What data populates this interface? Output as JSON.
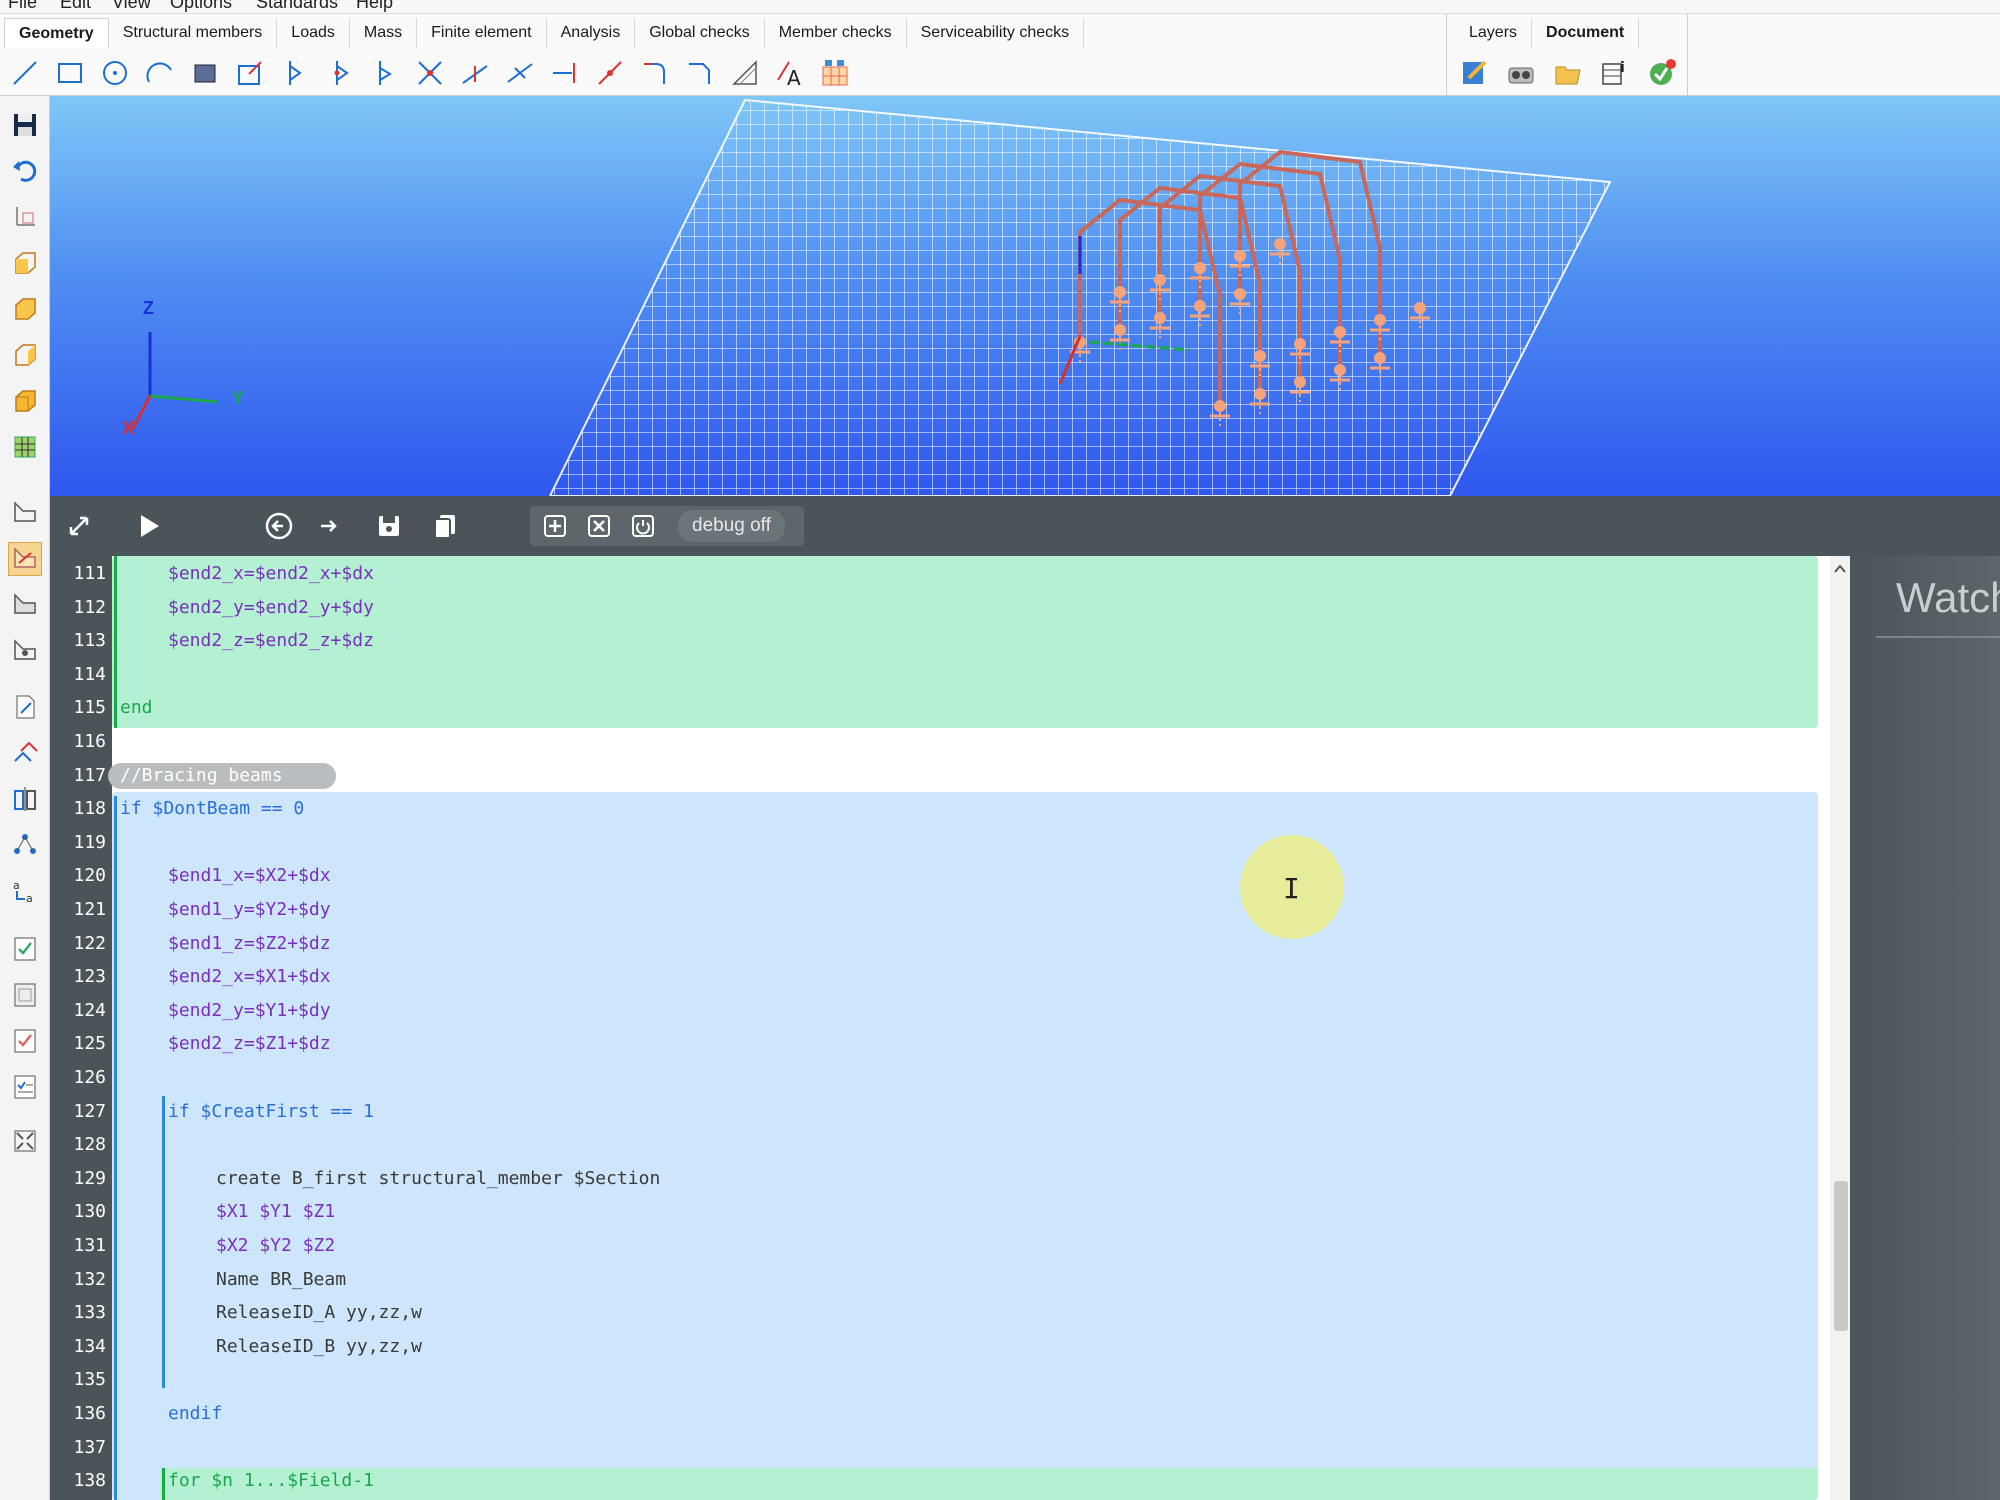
{
  "menu": [
    "File",
    "Edit",
    "View",
    "Options",
    "Standards",
    "Help"
  ],
  "ribbon": {
    "tabs": [
      "Geometry",
      "Structural members",
      "Loads",
      "Mass",
      "Finite element",
      "Analysis",
      "Global checks",
      "Member checks",
      "Serviceability checks"
    ],
    "active_tab": "Geometry",
    "doc_tabs": [
      "Layers",
      "Document"
    ]
  },
  "viewport": {
    "axis_z": "Z",
    "axis_y": "Y",
    "axis_x": "X"
  },
  "editor_toolbar": {
    "debug_label": "debug off"
  },
  "watch": {
    "title": "Watch"
  },
  "code_lines": [
    {
      "n": "111",
      "text": "$end2_x=$end2_x+$dx",
      "indent": 1,
      "color": "#7a2fbd"
    },
    {
      "n": "112",
      "text": "$end2_y=$end2_y+$dy",
      "indent": 1,
      "color": "#7a2fbd"
    },
    {
      "n": "113",
      "text": "$end2_z=$end2_z+$dz",
      "indent": 1,
      "color": "#7a2fbd"
    },
    {
      "n": "114",
      "text": "",
      "indent": 0,
      "color": "#333"
    },
    {
      "n": "115",
      "text": "end",
      "indent": 0,
      "color": "#1aa84a"
    },
    {
      "n": "116",
      "text": "",
      "indent": 0,
      "color": "#333"
    },
    {
      "n": "117",
      "text": "//Bracing beams",
      "indent": 0,
      "color": "#ffffff"
    },
    {
      "n": "118",
      "text": "if $DontBeam == 0",
      "indent": 0,
      "color": "#2a6fd6"
    },
    {
      "n": "119",
      "text": "",
      "indent": 0,
      "color": "#333"
    },
    {
      "n": "120",
      "text": "$end1_x=$X2+$dx",
      "indent": 1,
      "color": "#7a2fbd"
    },
    {
      "n": "121",
      "text": "$end1_y=$Y2+$dy",
      "indent": 1,
      "color": "#7a2fbd"
    },
    {
      "n": "122",
      "text": "$end1_z=$Z2+$dz",
      "indent": 1,
      "color": "#7a2fbd"
    },
    {
      "n": "123",
      "text": "$end2_x=$X1+$dx",
      "indent": 1,
      "color": "#7a2fbd"
    },
    {
      "n": "124",
      "text": "$end2_y=$Y1+$dy",
      "indent": 1,
      "color": "#7a2fbd"
    },
    {
      "n": "125",
      "text": "$end2_z=$Z1+$dz",
      "indent": 1,
      "color": "#7a2fbd"
    },
    {
      "n": "126",
      "text": "",
      "indent": 0,
      "color": "#333"
    },
    {
      "n": "127",
      "text": "if $CreatFirst == 1",
      "indent": 1,
      "color": "#2a6fd6"
    },
    {
      "n": "128",
      "text": "",
      "indent": 0,
      "color": "#333"
    },
    {
      "n": "129",
      "text": "create B_first structural_member $Section",
      "indent": 2,
      "color": "#3a3a3a"
    },
    {
      "n": "130",
      "text": "$X1 $Y1 $Z1",
      "indent": 2,
      "color": "#7a2fbd"
    },
    {
      "n": "131",
      "text": "$X2 $Y2 $Z2",
      "indent": 2,
      "color": "#7a2fbd"
    },
    {
      "n": "132",
      "text": "Name BR_Beam",
      "indent": 2,
      "color": "#3a3a3a"
    },
    {
      "n": "133",
      "text": "ReleaseID_A yy,zz,w",
      "indent": 2,
      "color": "#3a3a3a"
    },
    {
      "n": "134",
      "text": "ReleaseID_B yy,zz,w",
      "indent": 2,
      "color": "#3a3a3a"
    },
    {
      "n": "135",
      "text": "",
      "indent": 0,
      "color": "#333"
    },
    {
      "n": "136",
      "text": "endif",
      "indent": 1,
      "color": "#2a6fd6"
    },
    {
      "n": "137",
      "text": "",
      "indent": 0,
      "color": "#333"
    },
    {
      "n": "138",
      "text": "for $n 1...$Field-1",
      "indent": 1,
      "color": "#1aa84a"
    }
  ]
}
